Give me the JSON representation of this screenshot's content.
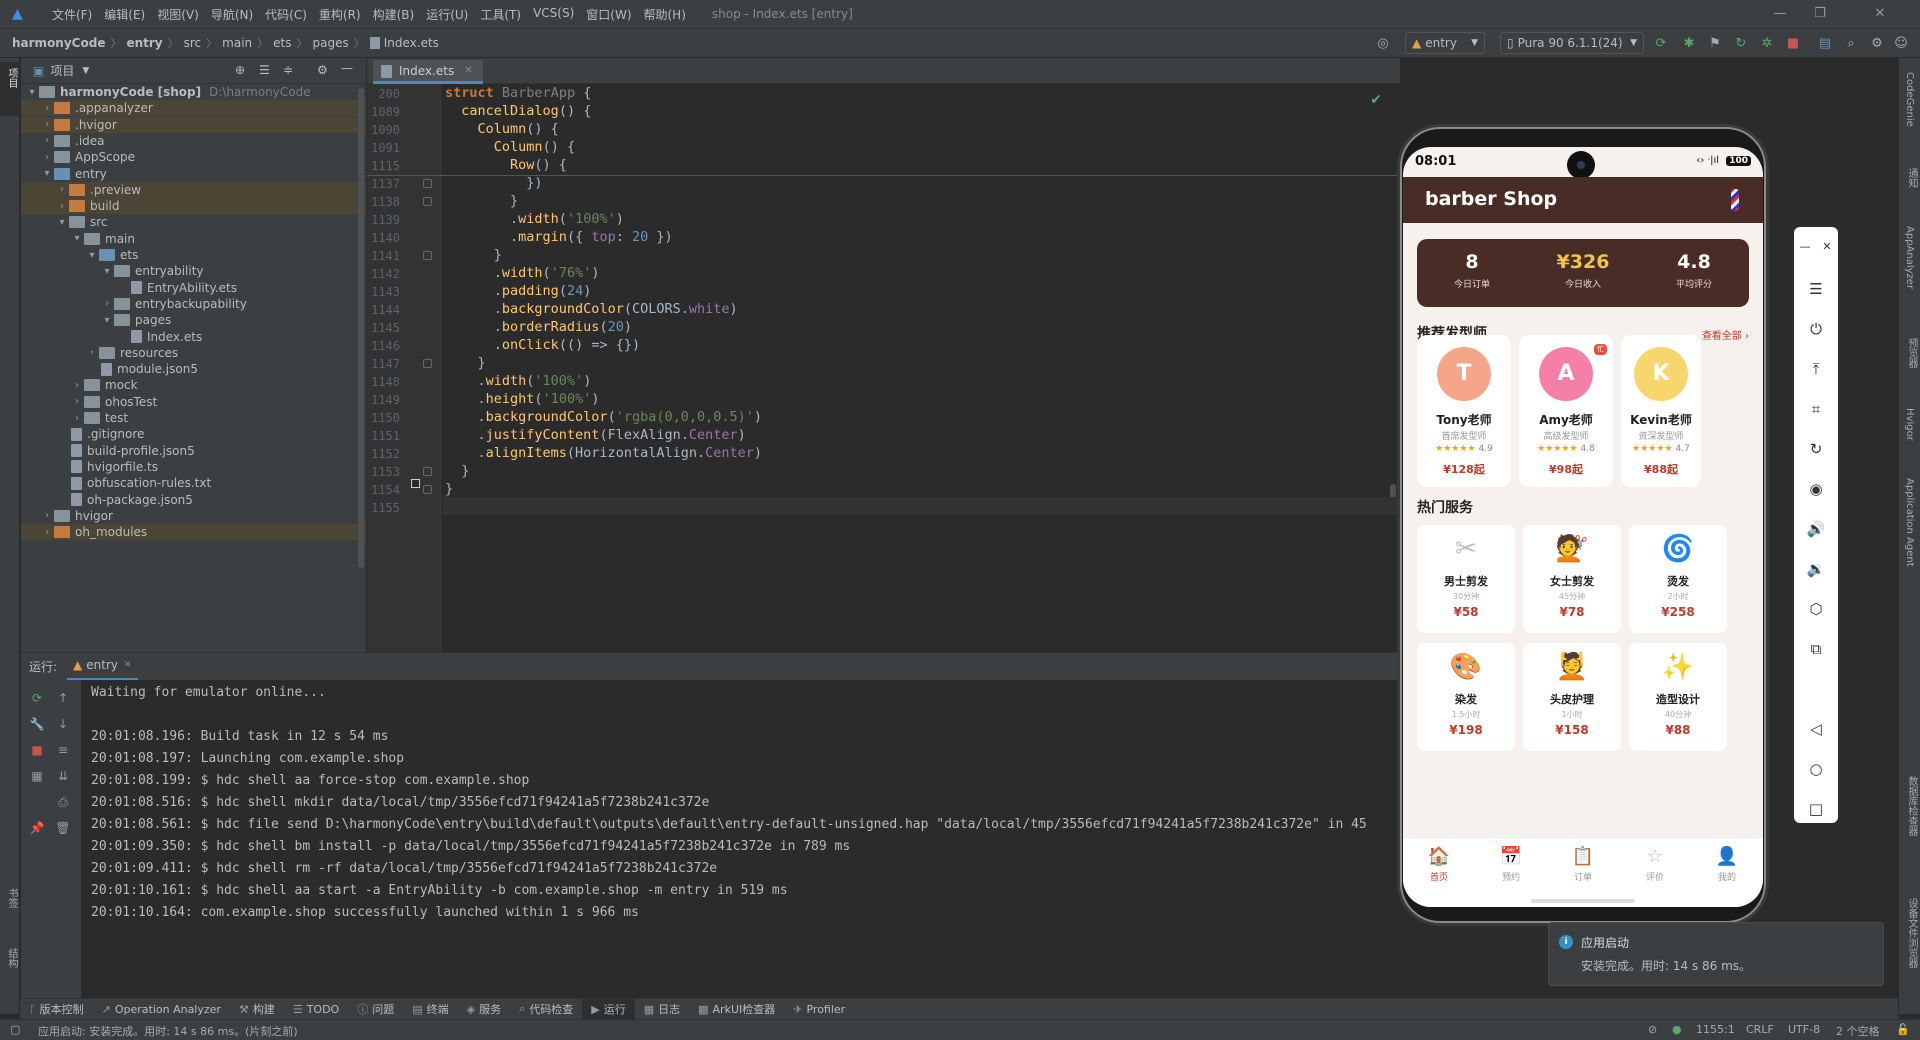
{
  "menu": {
    "items": [
      "文件(F)",
      "编辑(E)",
      "视图(V)",
      "导航(N)",
      "代码(C)",
      "重构(R)",
      "构建(B)",
      "运行(U)",
      "工具(T)",
      "VCS(S)",
      "窗口(W)",
      "帮助(H)"
    ],
    "window_title": "shop - Index.ets [entry]"
  },
  "breadcrumb": [
    "harmonyCode",
    "entry",
    "src",
    "main",
    "ets",
    "pages",
    "Index.ets"
  ],
  "toolbar": {
    "run_config": "entry",
    "device": "Pura 90 6.1.1(24)"
  },
  "project_panel": {
    "title": "项目",
    "tree": [
      {
        "label": "harmonyCode [shop]",
        "hint": "D:\\harmonyCode",
        "depth": 0,
        "type": "folder",
        "expanded": true
      },
      {
        "label": ".appanalyzer",
        "depth": 1,
        "type": "folder-excluded",
        "expanded": false
      },
      {
        "label": ".hvigor",
        "depth": 1,
        "type": "folder-excluded",
        "expanded": false
      },
      {
        "label": ".idea",
        "depth": 1,
        "type": "folder",
        "expanded": false
      },
      {
        "label": "AppScope",
        "depth": 1,
        "type": "folder",
        "expanded": false
      },
      {
        "label": "entry",
        "depth": 1,
        "type": "folder-module",
        "expanded": true
      },
      {
        "label": ".preview",
        "depth": 2,
        "type": "folder-excluded",
        "expanded": false
      },
      {
        "label": "build",
        "depth": 2,
        "type": "folder-excluded",
        "expanded": false
      },
      {
        "label": "src",
        "depth": 2,
        "type": "folder",
        "expanded": true
      },
      {
        "label": "main",
        "depth": 3,
        "type": "folder",
        "expanded": true
      },
      {
        "label": "ets",
        "depth": 4,
        "type": "folder-blue",
        "expanded": true
      },
      {
        "label": "entryability",
        "depth": 5,
        "type": "folder",
        "expanded": true
      },
      {
        "label": "EntryAbility.ets",
        "depth": 6,
        "type": "file"
      },
      {
        "label": "entrybackupability",
        "depth": 5,
        "type": "folder",
        "expanded": false
      },
      {
        "label": "pages",
        "depth": 5,
        "type": "folder",
        "expanded": true
      },
      {
        "label": "Index.ets",
        "depth": 6,
        "type": "file"
      },
      {
        "label": "resources",
        "depth": 4,
        "type": "folder",
        "expanded": false
      },
      {
        "label": "module.json5",
        "depth": 4,
        "type": "file"
      },
      {
        "label": "mock",
        "depth": 3,
        "type": "folder",
        "expanded": false
      },
      {
        "label": "ohosTest",
        "depth": 3,
        "type": "folder",
        "expanded": false
      },
      {
        "label": "test",
        "depth": 3,
        "type": "folder",
        "expanded": false
      },
      {
        "label": ".gitignore",
        "depth": 2,
        "type": "file"
      },
      {
        "label": "build-profile.json5",
        "depth": 2,
        "type": "file"
      },
      {
        "label": "hvigorfile.ts",
        "depth": 2,
        "type": "file"
      },
      {
        "label": "obfuscation-rules.txt",
        "depth": 2,
        "type": "file"
      },
      {
        "label": "oh-package.json5",
        "depth": 2,
        "type": "file"
      },
      {
        "label": "hvigor",
        "depth": 1,
        "type": "folder",
        "expanded": false
      },
      {
        "label": "oh_modules",
        "depth": 1,
        "type": "folder-excluded",
        "expanded": false
      }
    ]
  },
  "editor": {
    "tab": "Index.ets",
    "lines": [
      {
        "n": "200",
        "code": "<span class=\"k\">struct</span> <span class=\"cmt\">BarberApp</span> {"
      },
      {
        "n": "1089",
        "code": "  <span class=\"f\">cancelDialog</span>() {"
      },
      {
        "n": "1090",
        "code": "    <span class=\"f\">Column</span>() {"
      },
      {
        "n": "1091",
        "code": "      <span class=\"f\">Column</span>() {"
      },
      {
        "n": "1115",
        "code": "        <span class=\"f\">Row</span>() {"
      },
      {
        "n": "1137",
        "code": "          })"
      },
      {
        "n": "1138",
        "code": "        }"
      },
      {
        "n": "1139",
        "code": "        .<span class=\"f\">width</span>(<span class=\"s\">'100%'</span>)"
      },
      {
        "n": "1140",
        "code": "        .<span class=\"f\">margin</span>({ <span class=\"p\">top</span>: <span class=\"n\">20</span> })"
      },
      {
        "n": "1141",
        "code": "      }"
      },
      {
        "n": "1142",
        "code": "      .<span class=\"f\">width</span>(<span class=\"s\">'76%'</span>)"
      },
      {
        "n": "1143",
        "code": "      .<span class=\"f\">padding</span>(<span class=\"n\">24</span>)"
      },
      {
        "n": "1144",
        "code": "      .<span class=\"f\">backgroundColor</span>(COLORS.<span class=\"p\">white</span>)"
      },
      {
        "n": "1145",
        "code": "      .<span class=\"f\">borderRadius</span>(<span class=\"n\">20</span>)"
      },
      {
        "n": "1146",
        "code": "      .<span class=\"f\">onClick</span>(() => {})"
      },
      {
        "n": "1147",
        "code": "    }"
      },
      {
        "n": "1148",
        "code": "    .<span class=\"f\">width</span>(<span class=\"s\">'100%'</span>)"
      },
      {
        "n": "1149",
        "code": "    .<span class=\"f\">height</span>(<span class=\"s\">'100%'</span>)"
      },
      {
        "n": "1150",
        "code": "    .<span class=\"f\">backgroundColor</span>(<span class=\"s\">'rgba(0,0,0,0.5)'</span>)"
      },
      {
        "n": "1151",
        "code": "    .<span class=\"f\">justifyContent</span>(FlexAlign.<span class=\"p\">Center</span>)"
      },
      {
        "n": "1152",
        "code": "    .<span class=\"f\">alignItems</span>(HorizontalAlign.<span class=\"p\">Center</span>)"
      },
      {
        "n": "1153",
        "code": "  }"
      },
      {
        "n": "1154",
        "code": "}"
      },
      {
        "n": "1155",
        "code": ""
      }
    ]
  },
  "run_panel": {
    "label": "运行:",
    "tab": "entry",
    "console": [
      "Waiting for emulator online...",
      "",
      "20:01:08.196: Build task in 12 s 54 ms",
      "20:01:08.197: Launching com.example.shop",
      "20:01:08.199: $ hdc shell aa force-stop com.example.shop",
      "20:01:08.516: $ hdc shell mkdir data/local/tmp/3556efcd71f94241a5f7238b241c372e",
      "20:01:08.561: $ hdc file send D:\\harmonyCode\\entry\\build\\default\\outputs\\default\\entry-default-unsigned.hap \"data/local/tmp/3556efcd71f94241a5f7238b241c372e\" in 45",
      "20:01:09.350: $ hdc shell bm install -p data/local/tmp/3556efcd71f94241a5f7238b241c372e in 789 ms",
      "20:01:09.411: $ hdc shell rm -rf data/local/tmp/3556efcd71f94241a5f7238b241c372e",
      "20:01:10.161: $ hdc shell aa start -a EntryAbility -b com.example.shop -m entry in 519 ms",
      "20:01:10.164: com.example.shop successfully launched within 1 s 966 ms"
    ]
  },
  "bottom_tabs": [
    {
      "label": "版本控制",
      "icon": "branch-icon"
    },
    {
      "label": "Operation Analyzer",
      "icon": "chart-icon"
    },
    {
      "label": "构建",
      "icon": "hammer-icon"
    },
    {
      "label": "TODO",
      "icon": "list-icon"
    },
    {
      "label": "问题",
      "icon": "info-icon"
    },
    {
      "label": "终端",
      "icon": "terminal-icon"
    },
    {
      "label": "服务",
      "icon": "services-icon"
    },
    {
      "label": "代码检查",
      "icon": "inspect-icon"
    },
    {
      "label": "运行",
      "icon": "play-icon",
      "active": true
    },
    {
      "label": "日志",
      "icon": "log-icon"
    },
    {
      "label": "ArkUI检查器",
      "icon": "inspector-icon"
    },
    {
      "label": "Profiler",
      "icon": "profiler-icon"
    }
  ],
  "status": {
    "message": "应用启动: 安装完成。用时: 14 s 86 ms。(片刻之前)",
    "position": "1155:1",
    "line_sep": "CRLF",
    "encoding": "UTF-8",
    "indent": "2 个空格"
  },
  "left_strip": [
    "项目",
    "书签",
    "结构"
  ],
  "right_strip": [
    "CodeGenie",
    "通知",
    "AppAnalyzer",
    "预览器",
    "Hvigor",
    "Application Agent",
    "数据库检查器",
    "设备文件浏览器"
  ],
  "phone": {
    "time": "08:01",
    "battery": "100",
    "app_title": "barber Shop",
    "stats": [
      {
        "value": "8",
        "label": "今日订单"
      },
      {
        "value": "¥326",
        "label": "今日收入"
      },
      {
        "value": "4.8",
        "label": "平均评分"
      }
    ],
    "barbers_title": "推荐发型师",
    "barbers_link": "查看全部 ›",
    "barbers": [
      {
        "initial": "T",
        "name": "Tony老师",
        "title": "首席发型师",
        "stars": "★★★★★",
        "rating": "4.9",
        "price": "¥128起",
        "color": "#f4a58a"
      },
      {
        "initial": "A",
        "name": "Amy老师",
        "title": "高级发型师",
        "stars": "★★★★★",
        "rating": "4.8",
        "price": "¥98起",
        "color": "#f57fa7",
        "badge": "忙"
      },
      {
        "initial": "K",
        "name": "Kevin老师",
        "title": "资深发型师",
        "stars": "★★★★★",
        "rating": "4.7",
        "price": "¥88起",
        "color": "#f7d66e"
      }
    ],
    "services_title": "热门服务",
    "services": [
      {
        "icon": "✂",
        "name": "男士剪发",
        "dur": "30分钟",
        "price": "¥58"
      },
      {
        "icon": "💇",
        "name": "女士剪发",
        "dur": "45分钟",
        "price": "¥78"
      },
      {
        "icon": "🌀",
        "name": "烫发",
        "dur": "2小时",
        "price": "¥258"
      },
      {
        "icon": "🎨",
        "name": "染发",
        "dur": "1.5小时",
        "price": "¥198"
      },
      {
        "icon": "💆",
        "name": "头皮护理",
        "dur": "1小时",
        "price": "¥158"
      },
      {
        "icon": "✨",
        "name": "造型设计",
        "dur": "40分钟",
        "price": "¥88"
      }
    ],
    "tabs": [
      {
        "icon": "🏠",
        "label": "首页",
        "active": true
      },
      {
        "icon": "📅",
        "label": "预约"
      },
      {
        "icon": "📋",
        "label": "订单"
      },
      {
        "icon": "☆",
        "label": "评价"
      },
      {
        "icon": "👤",
        "label": "我的"
      }
    ]
  },
  "notification": {
    "title": "应用启动",
    "body": "安装完成。用时: 14 s 86 ms。"
  }
}
